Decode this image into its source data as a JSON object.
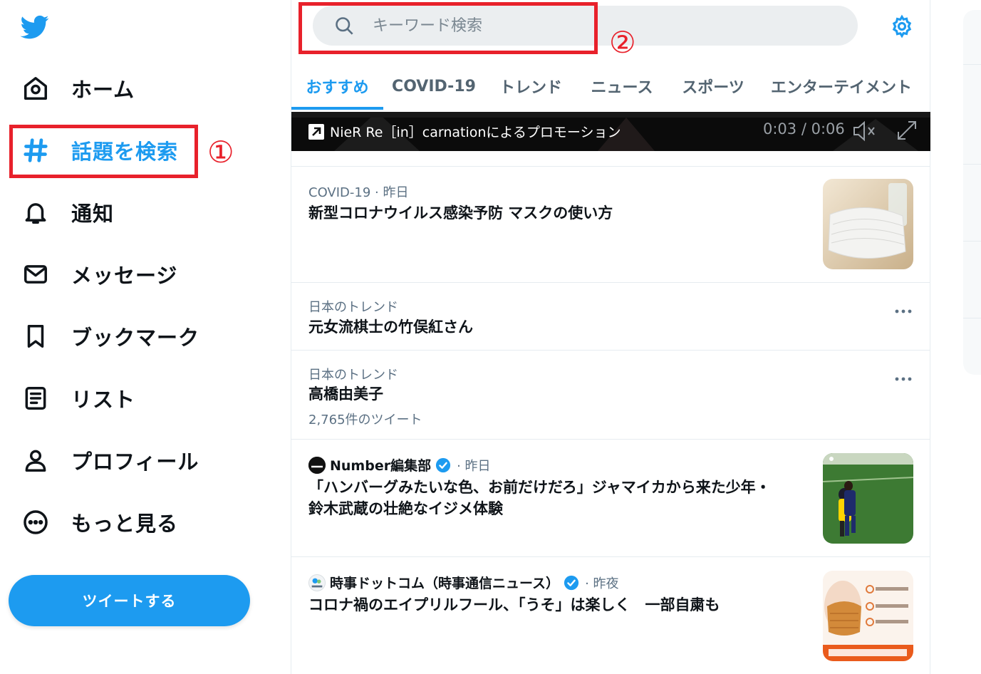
{
  "sidebar": {
    "items": [
      {
        "label": "ホーム",
        "icon": "home-icon"
      },
      {
        "label": "話題を検索",
        "icon": "hashtag-icon",
        "active": true
      },
      {
        "label": "通知",
        "icon": "bell-icon"
      },
      {
        "label": "メッセージ",
        "icon": "envelope-icon"
      },
      {
        "label": "ブックマーク",
        "icon": "bookmark-icon"
      },
      {
        "label": "リスト",
        "icon": "list-icon"
      },
      {
        "label": "プロフィール",
        "icon": "person-icon"
      },
      {
        "label": "もっと見る",
        "icon": "more-circle-icon"
      }
    ],
    "tweet_button": "ツイートする"
  },
  "annotations": {
    "one": "①",
    "two": "②"
  },
  "search": {
    "placeholder": "キーワード検索"
  },
  "tabs": [
    {
      "label": "おすすめ",
      "active": true
    },
    {
      "label": "COVID-19"
    },
    {
      "label": "トレンド"
    },
    {
      "label": "ニュース"
    },
    {
      "label": "スポーツ"
    },
    {
      "label": "エンターテイメント"
    }
  ],
  "promo": {
    "text": "NieR Re［in］carnationによるプロモーション",
    "time": "0:03 / 0:06"
  },
  "feed": [
    {
      "meta": "COVID-19 · 昨日",
      "title": "新型コロナウイルス感染予防 マスクの使い方"
    },
    {
      "meta": "日本のトレンド",
      "title": "元女流棋士の竹俣紅さん"
    },
    {
      "meta": "日本のトレンド",
      "title": "高橋由美子",
      "sub": "2,765件のツイート"
    },
    {
      "source": "Number編集部",
      "time": "· 昨日",
      "title_line1": "「ハンバーグみたいな色、お前だけだろ」ジャマイカから来た少年・",
      "title_line2": "鈴木武蔵の壮絶なイジメ体験"
    },
    {
      "source": "時事ドットコム（時事通信ニュース）",
      "time": "· 昨夜",
      "title": "コロナ禍のエイプリルフール、「うそ」は楽しく　一部自粛も"
    }
  ],
  "colors": {
    "accent": "#1d9bf0",
    "annotation": "#e8212b",
    "text": "#0f1419",
    "muted": "#5b7083"
  }
}
